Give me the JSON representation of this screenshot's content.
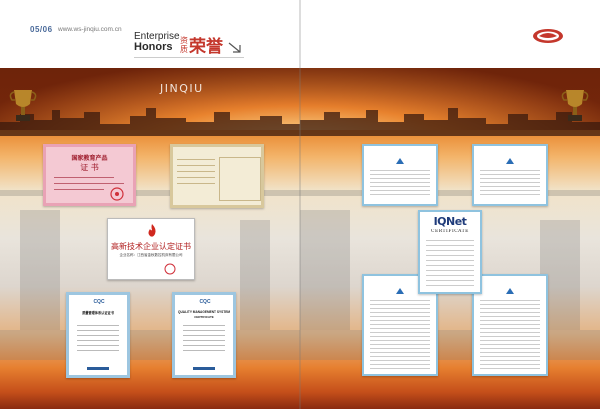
{
  "header": {
    "page_numbers": "05/06",
    "website": "www.ws-jinqiu.com.cn",
    "title_en_line1": "Enterprise",
    "title_en_line2": "Honors",
    "title_zh_small": "资质",
    "title_zh_big": "荣誉"
  },
  "banner": {
    "watermark": "JINQIU"
  },
  "certificates": {
    "pink": {
      "line1": "国家教育产品",
      "line2": "证 书"
    },
    "gaoxin": {
      "title": "高新技术企业认定证书",
      "subtitle": "企业名称：江西省金秋数控机床有限公司"
    },
    "cqc1": {
      "logo": "CQC",
      "title": "质量管理体系认证证书"
    },
    "cqc2": {
      "logo": "CQC",
      "title": "QUALITY MANAGEMENT SYSTEM",
      "subtitle": "CERTIFICATE"
    },
    "iqnet": {
      "logo": "IQNet",
      "title": "CERTIFICATE"
    }
  },
  "colors": {
    "accent_red": "#c4372c",
    "frame_blue": "#8fc3df",
    "url_gray": "#777777"
  }
}
